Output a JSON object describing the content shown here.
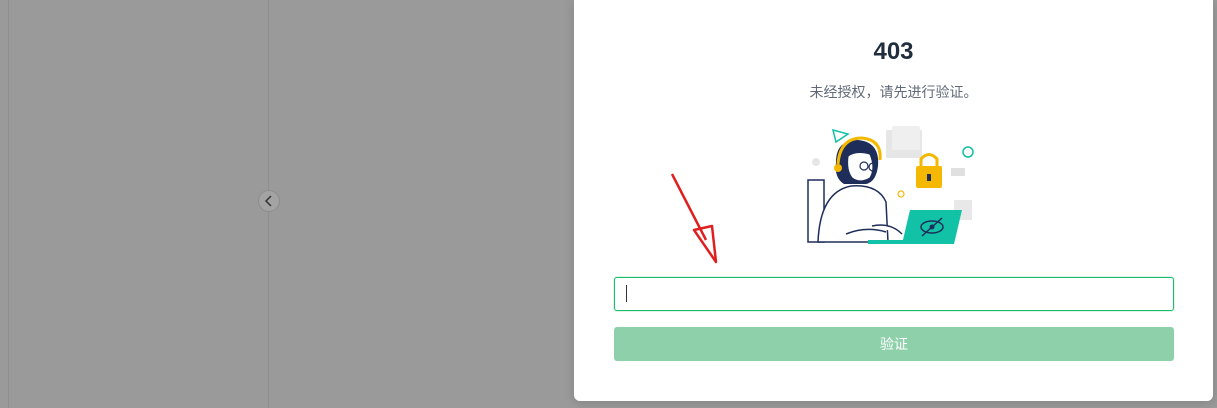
{
  "background": {
    "collapse_icon": "chevron-left-icon"
  },
  "dialog": {
    "error_code": "403",
    "message": "未经授权，请先进行验证。",
    "input": {
      "value": "",
      "placeholder": ""
    },
    "verify_button_label": "验证"
  },
  "colors": {
    "accent": "#19be6b",
    "button_disabled": "#8ed0aa",
    "illustration_teal": "#12c2a6",
    "lock_yellow": "#f5b800",
    "annotation_red": "#e02020"
  }
}
